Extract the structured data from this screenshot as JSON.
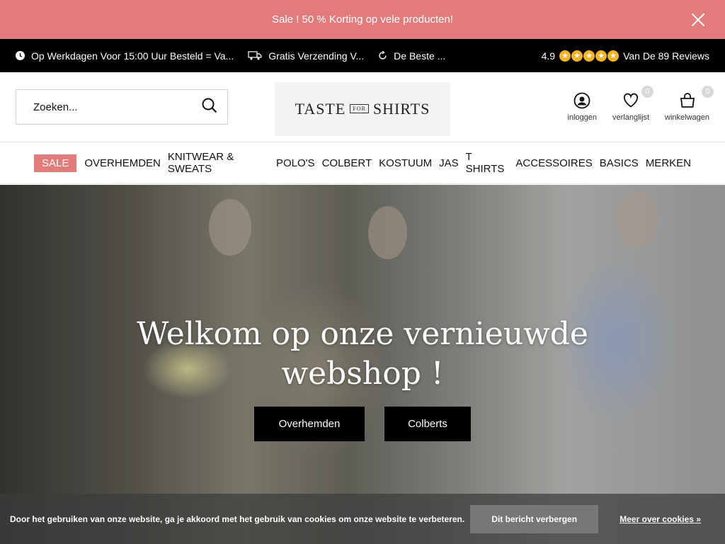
{
  "promo": {
    "text": "Sale ! 50 % Korting op vele producten!"
  },
  "usp": {
    "items": [
      {
        "icon": "clock-icon",
        "text": "Op Werkdagen Voor 15:00 Uur Besteld = Va..."
      },
      {
        "icon": "truck-icon",
        "text": "Gratis Verzending V..."
      },
      {
        "icon": "refresh-icon",
        "text": "De Beste ..."
      }
    ],
    "rating": {
      "score": "4.9",
      "stars": 5,
      "reviews_text": "Van De 89 Reviews"
    }
  },
  "header": {
    "search_placeholder": "Zoeken...",
    "logo": {
      "left": "TASTE",
      "middle": "FOR",
      "right": "SHIRTS"
    },
    "actions": [
      {
        "icon": "user-icon",
        "label": "inloggen"
      },
      {
        "icon": "heart-icon",
        "label": "verlanglijst",
        "badge": "0"
      },
      {
        "icon": "shopping-bag-icon",
        "label": "winkelwagen",
        "badge": "0"
      }
    ]
  },
  "nav": {
    "items": [
      "SALE",
      "OVERHEMDEN",
      "KNITWEAR & SWEATS",
      "POLO'S",
      "COLBERT",
      "KOSTUUM",
      "JAS",
      "T SHIRTS",
      "ACCESSOIRES",
      "BASICS",
      "MERKEN"
    ]
  },
  "hero": {
    "title_line1": "Welkom op onze vernieuwde",
    "title_line2": "webshop !",
    "buttons": [
      "Overhemden",
      "Colberts"
    ]
  },
  "cookie": {
    "text": "Door het gebruiken van onze website, ga je akkoord met het gebruik van cookies om onze website te verbeteren.",
    "button": "Dit bericht verbergen",
    "link": "Meer over cookies »"
  },
  "colors": {
    "accent": "#e27b7c",
    "star": "#f6b323",
    "topbar": "#000000"
  }
}
